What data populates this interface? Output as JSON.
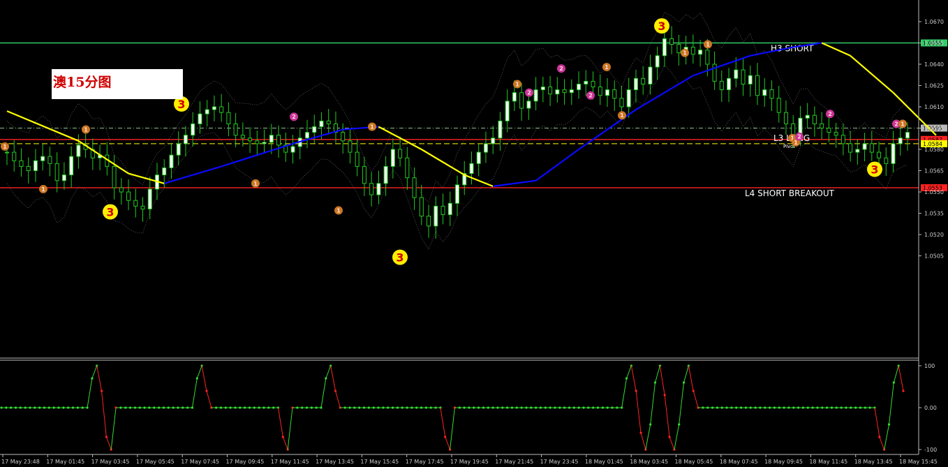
{
  "chart_title": "澳15分图",
  "chart_data": [
    {
      "type": "candlestick",
      "title": "澳15分图",
      "ylim": [
        1.05,
        1.0675
      ],
      "y_ticks": [
        "1.0670",
        "1.0655",
        "1.0640",
        "1.0625",
        "1.0610",
        "1.0595",
        "1.0580",
        "1.0565",
        "1.0550",
        "1.0535",
        "1.0520",
        "1.0505"
      ],
      "x_ticks": [
        "17 May 23:48",
        "17 May 01:45",
        "17 May 03:45",
        "17 May 05:45",
        "17 May 07:45",
        "17 May 09:45",
        "17 May 11:45",
        "17 May 13:45",
        "17 May 15:45",
        "17 May 17:45",
        "17 May 19:45",
        "17 May 21:45",
        "17 May 23:45",
        "18 May 01:45",
        "18 May 03:45",
        "18 May 05:45",
        "18 May 07:45",
        "18 May 09:45",
        "18 May 11:45",
        "18 May 13:45",
        "18 May 15:45"
      ],
      "levels": [
        {
          "label": "H3 SHORT",
          "value": 1.0655,
          "price_tag": "1.0655",
          "color": "#33cc66",
          "style": "solid"
        },
        {
          "label": "",
          "value": 1.0595,
          "price_tag": "1.0595",
          "color": "#8fbc8f",
          "style": "dash-dot"
        },
        {
          "label": "",
          "value": 1.0587,
          "price_tag": "1.0587",
          "color": "#ff2222",
          "style": "solid"
        },
        {
          "label": "L3 LONG",
          "value": 1.0584,
          "price_tag": "1.0584",
          "color": "#ffff00",
          "style": "dashed",
          "sub_label": "Pivot"
        },
        {
          "label": "L4 SHORT BREAKOUT",
          "value": 1.0553,
          "price_tag": "1.0553",
          "color": "#ff2222",
          "style": "solid"
        }
      ],
      "close_path": [
        1.0578,
        1.0572,
        1.0568,
        1.0565,
        1.0572,
        1.0575,
        1.057,
        1.0558,
        1.0562,
        1.0575,
        1.0583,
        1.058,
        1.0574,
        1.0576,
        1.0568,
        1.0553,
        1.055,
        1.0544,
        1.054,
        1.0538,
        1.0552,
        1.0562,
        1.0567,
        1.0576,
        1.0584,
        1.059,
        1.0598,
        1.0605,
        1.0608,
        1.061,
        1.0606,
        1.0598,
        1.059,
        1.0588,
        1.0586,
        1.0584,
        1.0585,
        1.059,
        1.0583,
        1.0578,
        1.0582,
        1.0588,
        1.0592,
        1.0596,
        1.06,
        1.0598,
        1.0592,
        1.0586,
        1.0578,
        1.0568,
        1.0556,
        1.0548,
        1.0556,
        1.0568,
        1.058,
        1.0574,
        1.056,
        1.0546,
        1.0533,
        1.0526,
        1.054,
        1.0534,
        1.0542,
        1.0555,
        1.0563,
        1.057,
        1.0578,
        1.0584,
        1.0588,
        1.06,
        1.0614,
        1.062,
        1.0609,
        1.0614,
        1.0622,
        1.0624,
        1.0619,
        1.0622,
        1.062,
        1.0622,
        1.0626,
        1.0628,
        1.0624,
        1.0618,
        1.0622,
        1.0616,
        1.061,
        1.0622,
        1.063,
        1.0626,
        1.0638,
        1.0646,
        1.0658,
        1.0654,
        1.0648,
        1.0652,
        1.0647,
        1.065,
        1.064,
        1.0628,
        1.0622,
        1.063,
        1.0636,
        1.0626,
        1.0632,
        1.0618,
        1.0622,
        1.0616,
        1.0606,
        1.0598,
        1.059,
        1.0602,
        1.0604,
        1.0598,
        1.0595,
        1.0592,
        1.059,
        1.0584,
        1.0578,
        1.058,
        1.0584,
        1.0578,
        1.0574,
        1.057,
        1.0584,
        1.0588,
        1.0592
      ],
      "moving_average": {
        "colors": [
          "#ffff00",
          "#0a0aff"
        ],
        "points": [
          [
            0,
            1.0607
          ],
          [
            10,
            1.0586
          ],
          [
            17,
            1.0563
          ],
          [
            22,
            1.0556
          ],
          [
            30,
            1.0568
          ],
          [
            40,
            1.0584
          ],
          [
            47,
            1.0594
          ],
          [
            52,
            1.0596
          ],
          [
            58,
            1.058
          ],
          [
            64,
            1.0562
          ],
          [
            68,
            1.0554
          ],
          [
            74,
            1.0558
          ],
          [
            80,
            1.058
          ],
          [
            88,
            1.0608
          ],
          [
            96,
            1.0632
          ],
          [
            104,
            1.0646
          ],
          [
            110,
            1.0652
          ],
          [
            114,
            1.0655
          ],
          [
            118,
            1.0646
          ],
          [
            124,
            1.062
          ],
          [
            130,
            1.059
          ]
        ]
      },
      "signals": [
        "1",
        "1",
        "3",
        "1",
        "3",
        "1",
        "2",
        "1",
        "3",
        "1",
        "1",
        "2",
        "2",
        "2",
        "1",
        "1",
        "1",
        "1",
        "2",
        "2",
        "3",
        "1",
        "1",
        "3",
        "1",
        "2"
      ]
    },
    {
      "type": "line",
      "ylim": [
        -100,
        100
      ],
      "y_ticks": [
        "100",
        "0.00",
        "-100"
      ],
      "colors": {
        "up": "#33dd33",
        "down": "#ff2222"
      },
      "values": [
        0,
        0,
        0,
        0,
        0,
        0,
        0,
        0,
        0,
        0,
        0,
        0,
        0,
        0,
        0,
        0,
        0,
        0,
        0,
        70,
        100,
        40,
        -70,
        -100,
        0,
        0,
        0,
        0,
        0,
        0,
        0,
        0,
        0,
        0,
        0,
        0,
        0,
        0,
        0,
        0,
        0,
        70,
        100,
        40,
        0,
        0,
        0,
        0,
        0,
        0,
        0,
        0,
        0,
        0,
        0,
        0,
        0,
        0,
        0,
        -70,
        -100,
        0,
        0,
        0,
        0,
        0,
        0,
        0,
        70,
        100,
        40,
        0,
        0,
        0,
        0,
        0,
        0,
        0,
        0,
        0,
        0,
        0,
        0,
        0,
        0,
        0,
        0,
        0,
        0,
        0,
        0,
        0,
        0,
        -70,
        -100,
        0,
        0,
        0,
        0,
        0,
        0,
        0,
        0,
        0,
        0,
        0,
        0,
        0,
        0,
        0,
        0,
        0,
        0,
        0,
        0,
        0,
        0,
        0,
        0,
        0,
        0,
        0,
        0,
        0,
        0,
        0,
        0,
        0,
        0,
        0,
        0,
        70,
        100,
        40,
        -60,
        -100,
        -40,
        60,
        100,
        30,
        -70,
        -100,
        -40,
        60,
        100,
        40,
        0,
        0,
        0,
        0,
        0,
        0,
        0,
        0,
        0,
        0,
        0,
        0,
        0,
        0,
        0,
        0,
        0,
        0,
        0,
        0,
        0,
        0,
        0,
        0,
        0,
        0,
        0,
        0,
        0,
        0,
        0,
        0,
        0,
        0,
        0,
        0,
        0,
        0,
        -70,
        -100,
        -40,
        60,
        100,
        40
      ]
    }
  ]
}
